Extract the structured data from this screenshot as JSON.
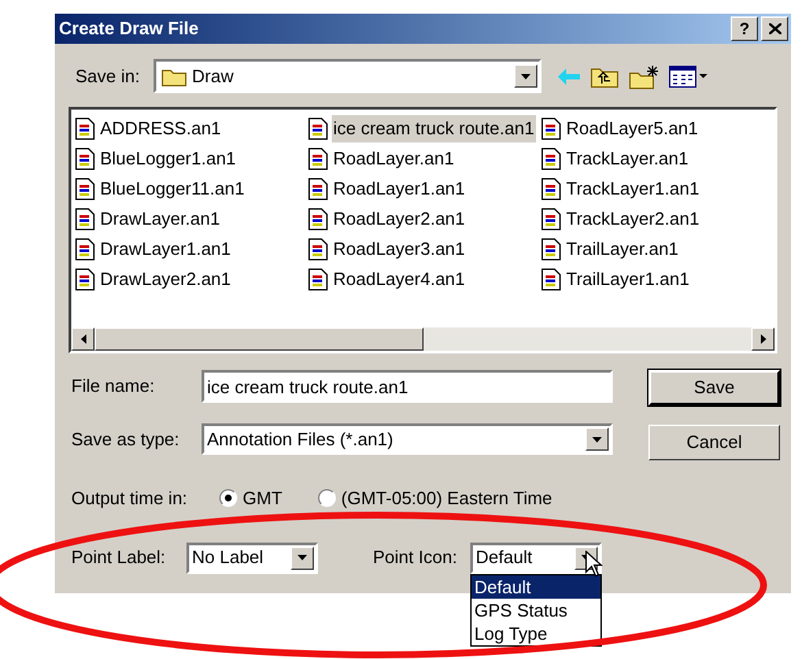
{
  "window": {
    "title": "Create Draw File",
    "help_button": "?"
  },
  "save_in": {
    "label": "Save in:",
    "value": "Draw"
  },
  "files": [
    {
      "name": "ADDRESS.an1",
      "selected": false
    },
    {
      "name": "BlueLogger1.an1",
      "selected": false
    },
    {
      "name": "BlueLogger11.an1",
      "selected": false
    },
    {
      "name": "DrawLayer.an1",
      "selected": false
    },
    {
      "name": "DrawLayer1.an1",
      "selected": false
    },
    {
      "name": "DrawLayer2.an1",
      "selected": false
    },
    {
      "name": "ice cream truck route.an1",
      "selected": true
    },
    {
      "name": "RoadLayer.an1",
      "selected": false
    },
    {
      "name": "RoadLayer1.an1",
      "selected": false
    },
    {
      "name": "RoadLayer2.an1",
      "selected": false
    },
    {
      "name": "RoadLayer3.an1",
      "selected": false
    },
    {
      "name": "RoadLayer4.an1",
      "selected": false
    },
    {
      "name": "RoadLayer5.an1",
      "selected": false
    },
    {
      "name": "TrackLayer.an1",
      "selected": false
    },
    {
      "name": "TrackLayer1.an1",
      "selected": false
    },
    {
      "name": "TrackLayer2.an1",
      "selected": false
    },
    {
      "name": "TrailLayer.an1",
      "selected": false
    },
    {
      "name": "TrailLayer1.an1",
      "selected": false
    }
  ],
  "file_name": {
    "label": "File name:",
    "value": "ice cream truck route.an1"
  },
  "save_as_type": {
    "label": "Save as type:",
    "value": "Annotation Files (*.an1)"
  },
  "buttons": [
    "Save",
    "Cancel"
  ],
  "output_time": {
    "label": "Output time in:",
    "options": [
      {
        "label": "GMT",
        "selected": true
      },
      {
        "label": "(GMT-05:00) Eastern Time",
        "selected": false
      }
    ]
  },
  "point_label": {
    "label": "Point Label:",
    "value": "No Label"
  },
  "point_icon": {
    "label": "Point Icon:",
    "value": "Default",
    "expanded": true,
    "options": [
      {
        "label": "Default",
        "selected": true
      },
      {
        "label": "GPS Status",
        "selected": false
      },
      {
        "label": "Log Type",
        "selected": false
      }
    ]
  }
}
